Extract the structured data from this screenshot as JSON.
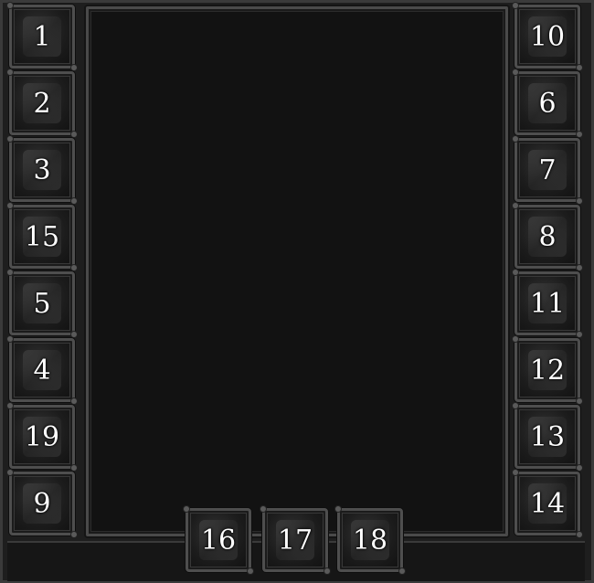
{
  "left_slots": [
    {
      "label": "1",
      "icon": "helmet-icon"
    },
    {
      "label": "2",
      "icon": "amulet-icon"
    },
    {
      "label": "3",
      "icon": "shoulders-icon"
    },
    {
      "label": "15",
      "icon": "chest-icon"
    },
    {
      "label": "5",
      "icon": "legs-icon"
    },
    {
      "label": "4",
      "icon": "gloves-icon"
    },
    {
      "label": "19",
      "icon": "bracers-icon"
    },
    {
      "label": "9",
      "icon": "belt-icon"
    }
  ],
  "right_slots": [
    {
      "label": "10",
      "icon": "shirt-icon"
    },
    {
      "label": "6",
      "icon": "cloak-icon"
    },
    {
      "label": "7",
      "icon": "waist-icon"
    },
    {
      "label": "8",
      "icon": "boots-icon"
    },
    {
      "label": "11",
      "icon": "ring-icon"
    },
    {
      "label": "12",
      "icon": "ring-icon"
    },
    {
      "label": "13",
      "icon": "trinket-icon"
    },
    {
      "label": "14",
      "icon": "trinket-icon"
    }
  ],
  "bottom_slots": [
    {
      "label": "16",
      "icon": "main-hand-weapon-icon"
    },
    {
      "label": "17",
      "icon": "shield-icon"
    },
    {
      "label": "18",
      "icon": "ranged-weapon-icon"
    }
  ]
}
